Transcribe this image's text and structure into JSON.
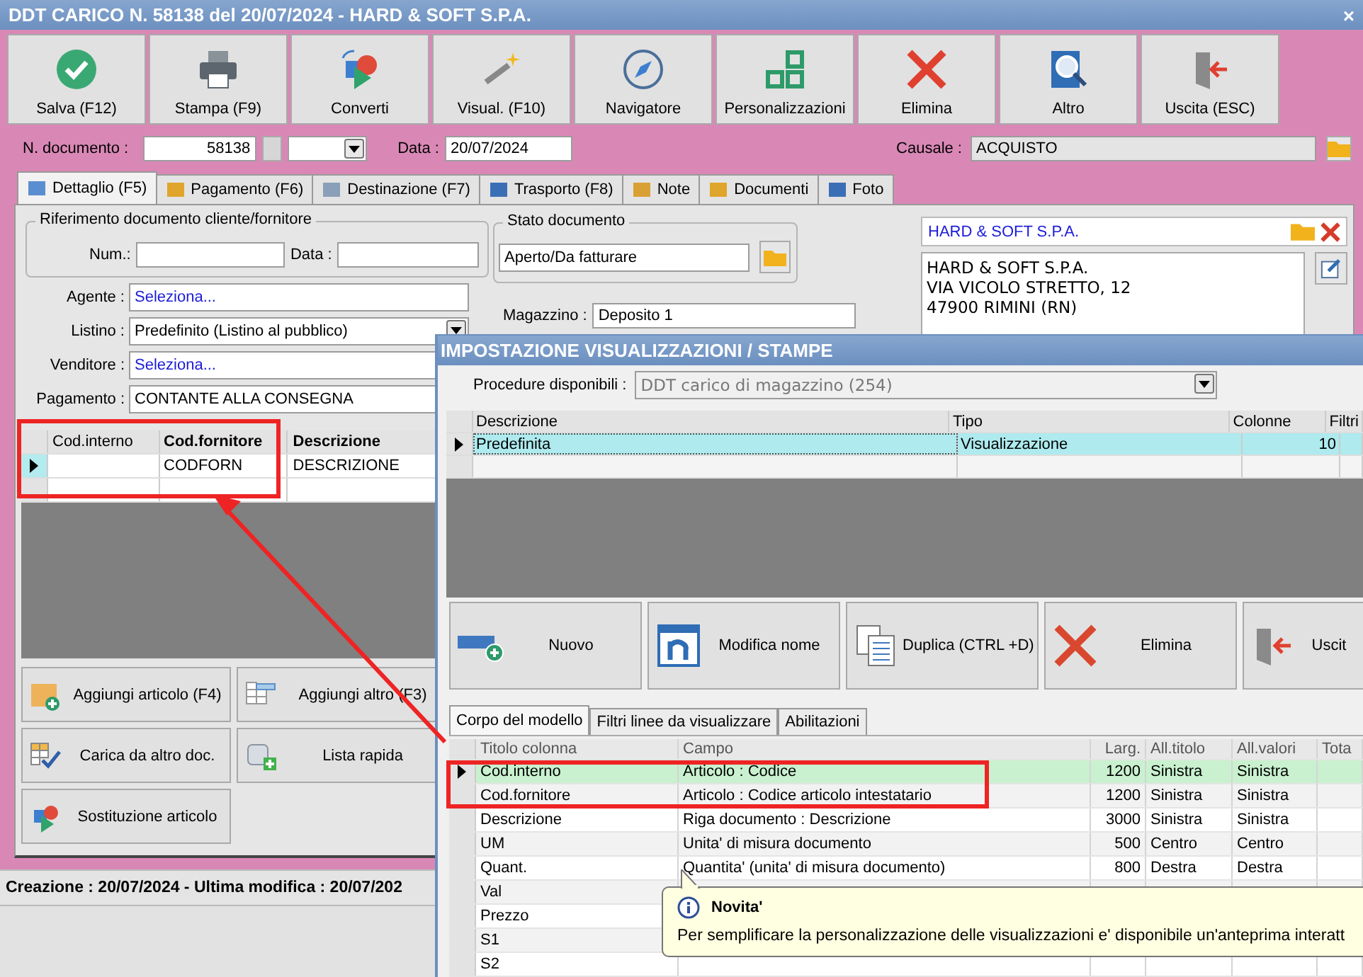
{
  "window": {
    "title": "DDT CARICO N. 58138 del 20/07/2024 - HARD & SOFT S.P.A.",
    "close": "×"
  },
  "toolbar": [
    {
      "label": "Salva (F12)"
    },
    {
      "label": "Stampa (F9)"
    },
    {
      "label": "Converti"
    },
    {
      "label": "Visual. (F10)"
    },
    {
      "label": "Navigatore"
    },
    {
      "label": "Personalizzazioni"
    },
    {
      "label": "Elimina"
    },
    {
      "label": "Altro"
    },
    {
      "label": "Uscita (ESC)"
    }
  ],
  "header": {
    "doc_label": "N. documento :",
    "doc_number": "58138",
    "date_label": "Data :",
    "date": "20/07/2024",
    "causale_label": "Causale :",
    "causale": "ACQUISTO"
  },
  "tabs": [
    {
      "label": "Dettaglio (F5)",
      "selected": true
    },
    {
      "label": "Pagamento (F6)",
      "selected": false
    },
    {
      "label": "Destinazione (F7)",
      "selected": false
    },
    {
      "label": "Trasporto (F8)",
      "selected": false
    },
    {
      "label": "Note",
      "selected": false
    },
    {
      "label": "Documenti",
      "selected": false
    },
    {
      "label": "Foto",
      "selected": false
    }
  ],
  "riferimento": {
    "legend": "Riferimento documento cliente/fornitore",
    "num_label": "Num.:",
    "data_label": "Data :"
  },
  "fields": [
    {
      "label": "Agente :",
      "value": "Seleziona...",
      "kind": "link"
    },
    {
      "label": "Listino :",
      "value": "Predefinito (Listino al pubblico)",
      "kind": "combo"
    },
    {
      "label": "Venditore :",
      "value": "Seleziona...",
      "kind": "link"
    },
    {
      "label": "Pagamento :",
      "value": "CONTANTE ALLA CONSEGNA",
      "kind": "text"
    }
  ],
  "stato": {
    "legend": "Stato documento",
    "value": "Aperto/Da fatturare"
  },
  "magazzino": {
    "label": "Magazzino :",
    "value": "Deposito 1"
  },
  "intestatario": {
    "name": "HARD & SOFT S.P.A.",
    "address": [
      "HARD & SOFT S.P.A.",
      "VIA VICOLO STRETTO, 12",
      "47900 RIMINI (RN)"
    ]
  },
  "grid": {
    "columns": [
      {
        "label": "Cod.interno",
        "bold": false
      },
      {
        "label": "Cod.fornitore",
        "bold": true
      },
      {
        "label": "Descrizione",
        "bold": true
      }
    ],
    "rows": [
      {
        "cod_fornitore": "CODFORN",
        "descrizione": "DESCRIZIONE",
        "selected": true
      }
    ]
  },
  "actions": [
    {
      "label": "Aggiungi articolo (F4)"
    },
    {
      "label": "Aggiungi altro (F3)"
    },
    {
      "label": "Carica da altro doc."
    },
    {
      "label": "Lista rapida"
    },
    {
      "label": "Sostituzione articolo"
    }
  ],
  "status_bar": "Creazione : 20/07/2024 - Ultima modifica : 20/07/202",
  "dialog": {
    "title": "IMPOSTAZIONE VISUALIZZAZIONI / STAMPE",
    "procedure_label": "Procedure disponibili :",
    "procedure": "DDT carico di magazzino (254)",
    "models": {
      "columns": [
        "Descrizione",
        "Tipo",
        "Colonne",
        "Filtri"
      ],
      "rows": [
        {
          "descrizione": "Predefinita",
          "tipo": "Visualizzazione",
          "colonne": "10",
          "selected": true
        }
      ]
    },
    "buttons": [
      {
        "label": "Nuovo"
      },
      {
        "label": "Modifica nome"
      },
      {
        "label": "Duplica (CTRL +D)"
      },
      {
        "label": "Elimina"
      },
      {
        "label": "Uscit"
      }
    ],
    "tabs": [
      {
        "label": "Corpo del modello",
        "selected": true
      },
      {
        "label": "Filtri linee da visualizzare",
        "selected": false
      },
      {
        "label": "Abilitazioni",
        "selected": false
      }
    ],
    "columns_grid": {
      "columns": [
        "Titolo colonna",
        "Campo",
        "Larg.",
        "All.titolo",
        "All.valori",
        "Tota"
      ],
      "rows": [
        {
          "titolo": "Cod.interno",
          "campo": "Articolo : Codice",
          "larg": "1200",
          "all_titolo": "Sinistra",
          "all_valori": "Sinistra",
          "selected": true
        },
        {
          "titolo": "Cod.fornitore",
          "campo": "Articolo : Codice articolo intestatario",
          "larg": "1200",
          "all_titolo": "Sinistra",
          "all_valori": "Sinistra",
          "selected": false
        },
        {
          "titolo": "Descrizione",
          "campo": "Riga documento : Descrizione",
          "larg": "3000",
          "all_titolo": "Sinistra",
          "all_valori": "Sinistra",
          "selected": false
        },
        {
          "titolo": "UM",
          "campo": "Unita' di misura documento",
          "larg": "500",
          "all_titolo": "Centro",
          "all_valori": "Centro",
          "selected": false
        },
        {
          "titolo": "Quant.",
          "campo": "Quantita' (unita' di misura documento)",
          "larg": "800",
          "all_titolo": "Destra",
          "all_valori": "Destra",
          "selected": false
        },
        {
          "titolo": "Val",
          "selected": false
        },
        {
          "titolo": "Prezzo",
          "selected": false
        },
        {
          "titolo": "S1",
          "selected": false
        },
        {
          "titolo": "S2",
          "selected": false
        }
      ]
    }
  },
  "tooltip": {
    "title": "Novita'",
    "text": "Per semplificare la personalizzazione delle visualizzazioni e' disponibile un'anteprima interatt"
  }
}
